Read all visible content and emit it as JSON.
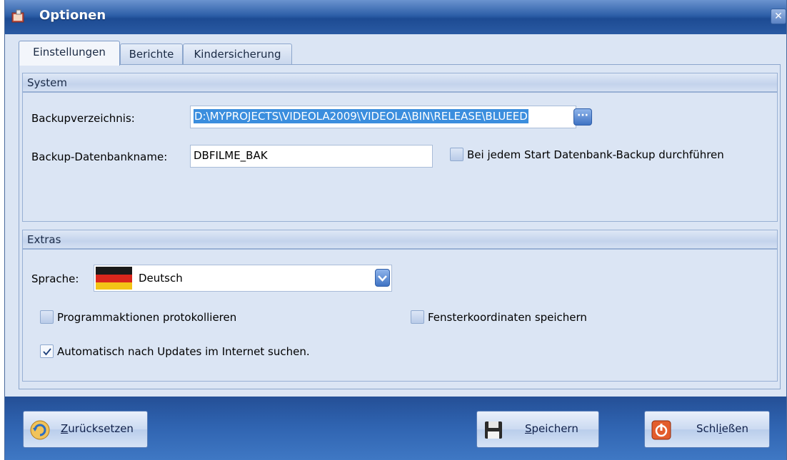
{
  "window": {
    "title": "Optionen"
  },
  "tabs": [
    "Einstellungen",
    "Berichte",
    "Kindersicherung"
  ],
  "system": {
    "header": "System",
    "backup_dir_label": "Backupverzeichnis:",
    "backup_dir_value": "D:\\MYPROJECTS\\VIDEOLA2009\\VIDEOLA\\BIN\\RELEASE\\BLUEED",
    "backup_name_label": "Backup-Datenbankname:",
    "backup_name_value": "DBFILME_BAK",
    "backup_on_start_label": "Bei jedem Start Datenbank-Backup durchführen",
    "backup_on_start_checked": false
  },
  "extras": {
    "header": "Extras",
    "language_label": "Sprache:",
    "language_value": "Deutsch",
    "log_actions_label": "Programmaktionen protokollieren",
    "log_actions_checked": false,
    "save_window_coords_label": "Fensterkoordinaten  speichern",
    "save_window_coords_checked": false,
    "auto_update_label": "Automatisch nach Updates im Internet suchen.",
    "auto_update_checked": true
  },
  "footer": {
    "reset": {
      "mnemonic": "Z",
      "rest": "urücksetzen"
    },
    "save": {
      "mnemonic": "S",
      "rest": "peichern"
    },
    "close": {
      "pre": "Schl",
      "mnemonic": "i",
      "post": "eßen"
    }
  },
  "colors": {
    "title_bar": "#2d5fa8",
    "footer": "#2f63b0",
    "panel_bg": "#dbe5f4",
    "selection": "#3b8ede"
  },
  "icons": [
    "app-icon",
    "close-icon",
    "ellipsis-icon",
    "german-flag-icon",
    "dropdown-arrow-icon",
    "reset-icon",
    "floppy-disk-icon",
    "power-icon",
    "checkmark-icon"
  ]
}
